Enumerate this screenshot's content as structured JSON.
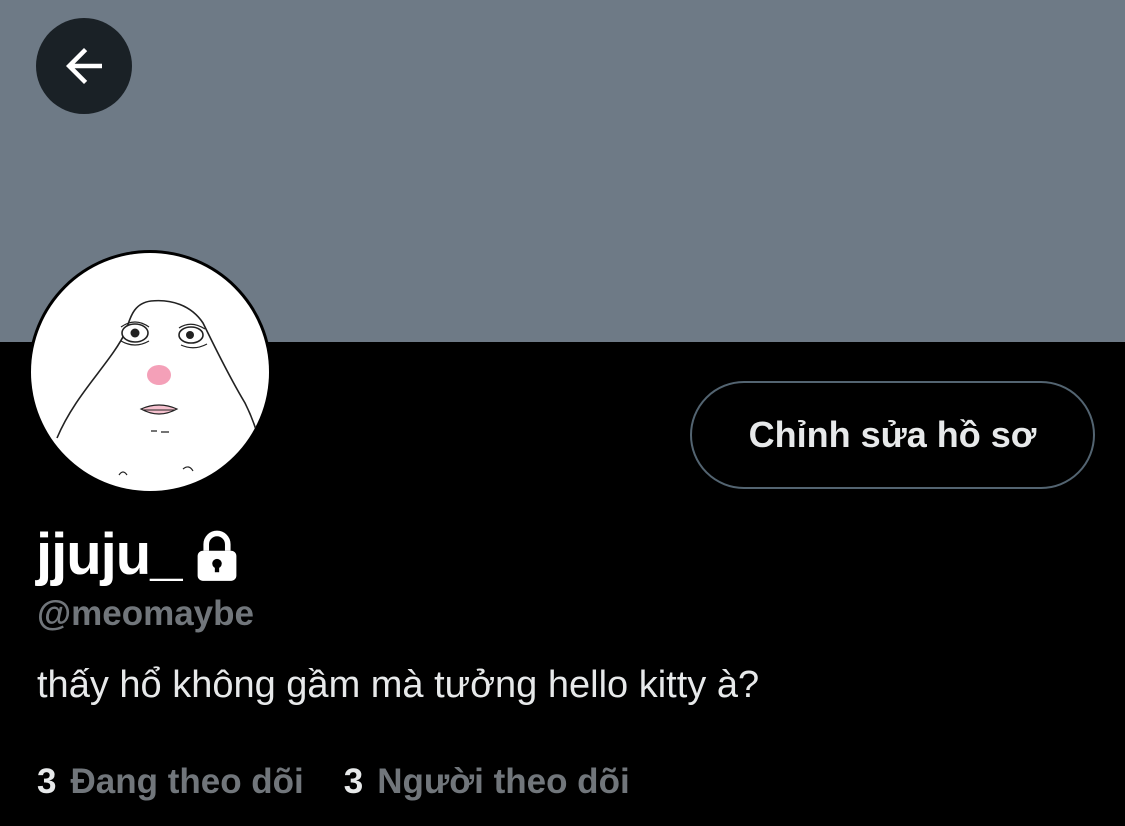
{
  "colors": {
    "banner": "#6e7a86",
    "background": "#000000",
    "text_primary": "#e7e9ea",
    "text_secondary": "#71767b",
    "button_border": "#536471"
  },
  "header": {
    "back_icon": "arrow-left-icon"
  },
  "profile": {
    "avatar_icon": "avatar-sketch-image",
    "edit_button_label": "Chỉnh sửa hồ sơ",
    "display_name": "jjuju_",
    "protected_icon": "lock-icon",
    "handle": "@meomaybe",
    "bio": "thấy hổ không gầm mà tưởng hello kitty à?"
  },
  "stats": {
    "following_count": "3",
    "following_label": "Đang theo dõi",
    "followers_count": "3",
    "followers_label": "Người theo dõi"
  }
}
